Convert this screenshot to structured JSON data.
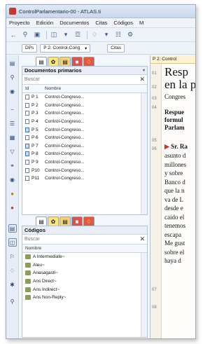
{
  "window": {
    "title": "ControlParlamentario-00 - ATLAS.ti"
  },
  "menu": [
    "Proyecto",
    "Edición",
    "Documentos",
    "Citas",
    "Códigos",
    "M"
  ],
  "docbar": {
    "dps_label": "DPs",
    "doc_combo": "P 2: Control-Cong",
    "citas_label": "Citas"
  },
  "docs_pane": {
    "title": "Documentos primarios",
    "search_placeholder": "Buscar",
    "col_id": "Id",
    "col_name": "Nombre",
    "rows": [
      {
        "id": "P 1",
        "name": "Control-Congreso...",
        "coded": false
      },
      {
        "id": "P 2",
        "name": "Control-Congreso...",
        "coded": false
      },
      {
        "id": "P 3",
        "name": "Control-Congreso...",
        "coded": false
      },
      {
        "id": "P 4",
        "name": "Control-Congreso...",
        "coded": false
      },
      {
        "id": "P 5",
        "name": "Control-Congreso...",
        "coded": true
      },
      {
        "id": "P 6",
        "name": "Control-Congreso...",
        "coded": false
      },
      {
        "id": "P 7",
        "name": "Control-Congreso...",
        "coded": true
      },
      {
        "id": "P 8",
        "name": "Control-Congreso...",
        "coded": true
      },
      {
        "id": "P 9",
        "name": "Control-Congreso...",
        "coded": false
      },
      {
        "id": "P10",
        "name": "Control-Congreso...",
        "coded": false
      },
      {
        "id": "P11",
        "name": "Control-Congreso...",
        "coded": false
      }
    ]
  },
  "codes_pane": {
    "title": "Códigos",
    "search_placeholder": "Buscar",
    "col_name": "Nombre",
    "rows": [
      "A Intermediate~",
      "Aleu~",
      "Anasagasti~",
      "Ans Direct~",
      "Ans Indirect~",
      "Ans Non-Reply~"
    ]
  },
  "doc_view": {
    "tab_label": "P 2: Control",
    "line_numbers": [
      "01",
      "02",
      "03",
      "04",
      "05",
      "06",
      "07",
      "08"
    ],
    "title_line1": "Resp",
    "title_line2": "en la p",
    "subtitle": "Congres",
    "bold_lines": [
      "Respue",
      "formul",
      "Parlam"
    ],
    "speaker": "Sr. Ra",
    "body_lines": [
      "asunto d",
      "millones",
      "y sobre",
      "Banco d",
      "que la n",
      "va de L",
      "desde e",
      "caído el",
      "tenemos",
      "escapa",
      "Me gust",
      "sobre el",
      "haya d"
    ]
  }
}
